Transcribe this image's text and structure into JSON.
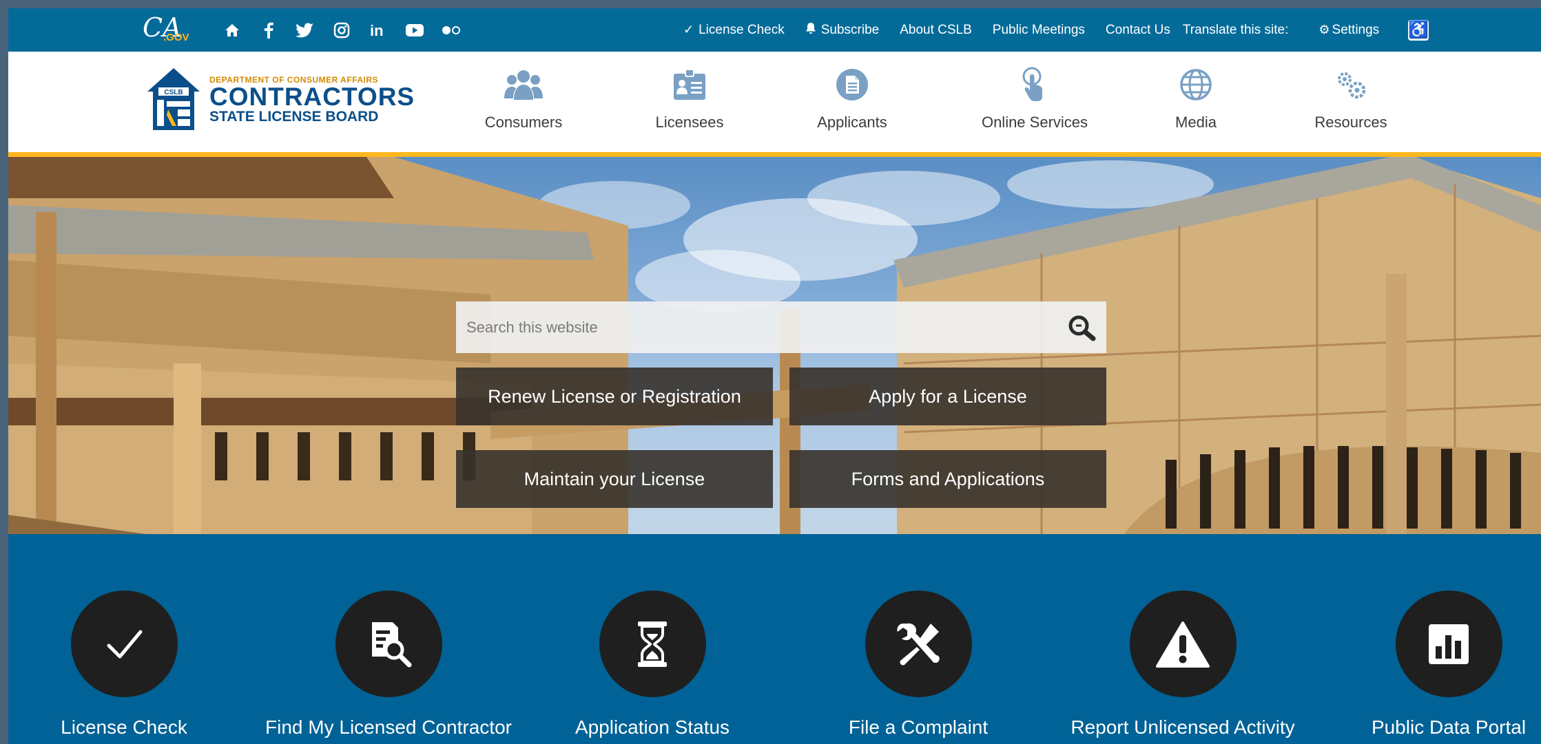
{
  "topbar": {
    "logo": {
      "ca": "CA",
      "gov": ".GOV"
    },
    "social_icons": [
      "home-icon",
      "facebook-icon",
      "twitter-icon",
      "instagram-icon",
      "linkedin-icon",
      "youtube-icon",
      "flickr-icon"
    ],
    "links": {
      "license_check": "License Check",
      "subscribe": "Subscribe",
      "about": "About CSLB",
      "public_meetings": "Public Meetings",
      "contact": "Contact Us",
      "translate": "Translate this site:",
      "settings": "Settings"
    },
    "accessibility_icon": "wheelchair-icon"
  },
  "header": {
    "logo": {
      "badge": "CSLB",
      "dept": "DEPARTMENT OF CONSUMER AFFAIRS",
      "line1": "CONTRACTORS",
      "line2": "STATE LICENSE BOARD"
    },
    "nav": [
      {
        "label": "Consumers",
        "icon": "people-icon"
      },
      {
        "label": "Licensees",
        "icon": "id-card-icon"
      },
      {
        "label": "Applicants",
        "icon": "document-icon"
      },
      {
        "label": "Online Services",
        "icon": "touch-icon"
      },
      {
        "label": "Media",
        "icon": "globe-icon"
      },
      {
        "label": "Resources",
        "icon": "gears-icon"
      }
    ]
  },
  "hero": {
    "search": {
      "placeholder": "Search this website"
    },
    "buttons": {
      "renew": "Renew License or Registration",
      "apply": "Apply for a License",
      "maintain": "Maintain your License",
      "forms": "Forms and Applications"
    }
  },
  "quick_links": [
    {
      "label": "License Check",
      "icon": "checkmark-icon"
    },
    {
      "label": "Find My Licensed Contractor",
      "icon": "document-search-icon"
    },
    {
      "label": "Application Status",
      "icon": "hourglass-icon"
    },
    {
      "label": "File a Complaint",
      "icon": "tools-icon"
    },
    {
      "label": "Report Unlicensed Activity",
      "icon": "warning-icon"
    },
    {
      "label": "Public Data Portal",
      "icon": "bar-chart-icon"
    }
  ],
  "colors": {
    "topbar": "#046b99",
    "accent_gold": "#fdb81e",
    "quick_band": "#006296",
    "nav_icon": "#7aa0c4",
    "logo_blue": "#0b4f8a"
  }
}
